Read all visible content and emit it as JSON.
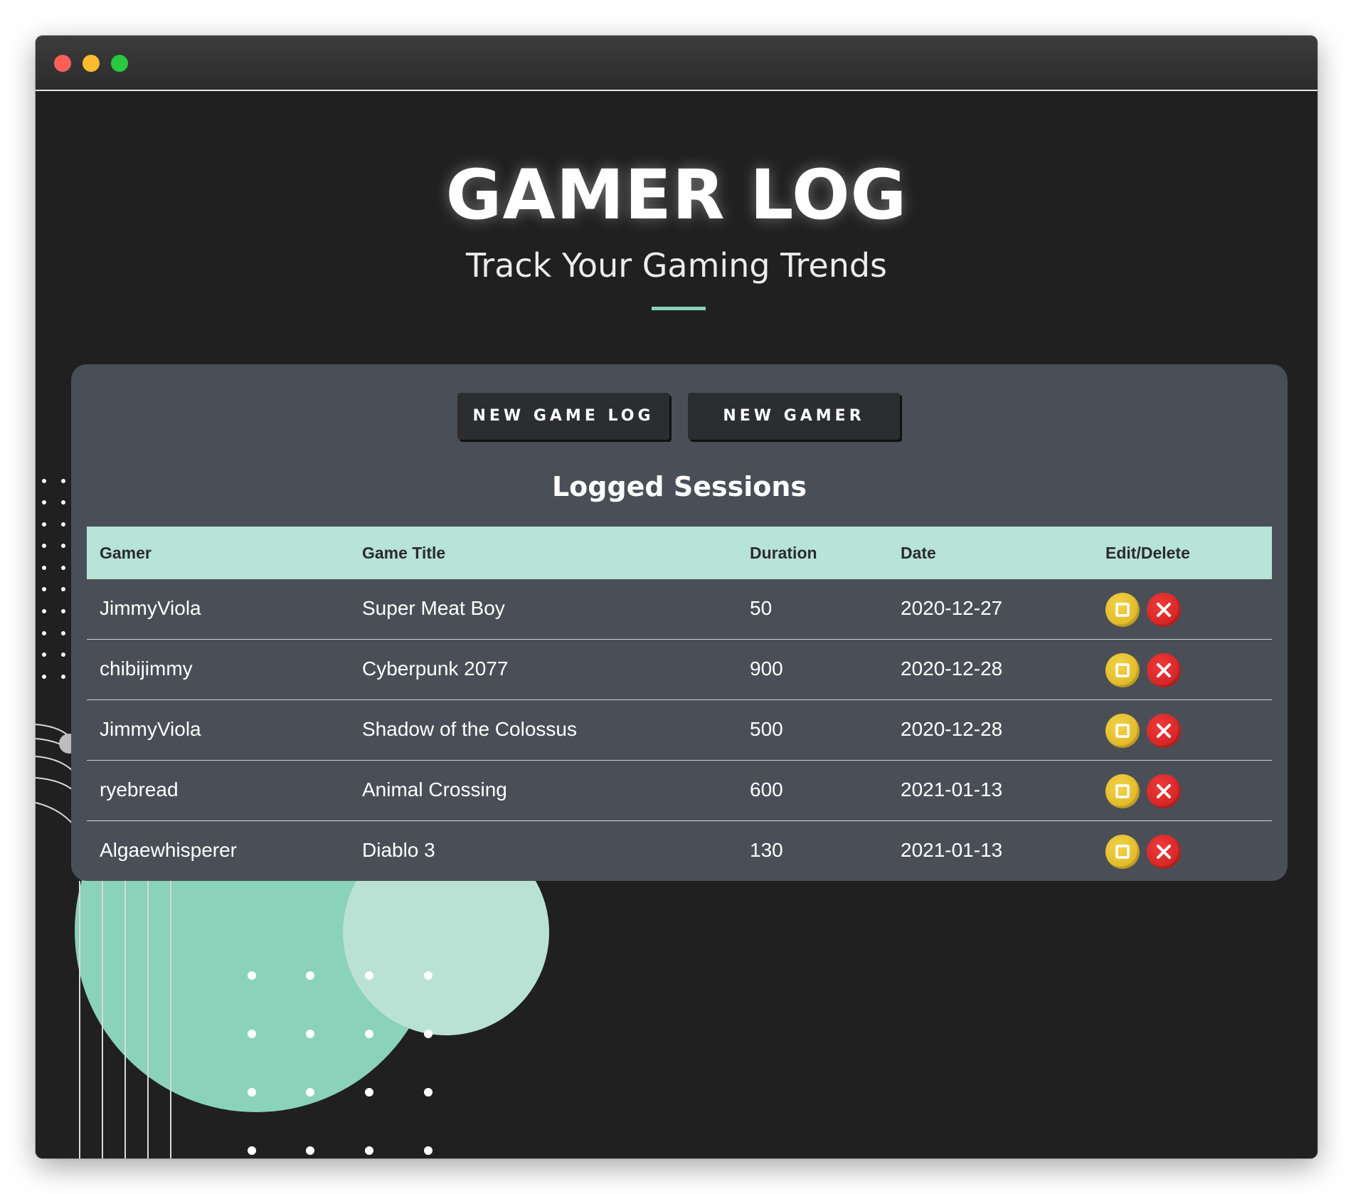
{
  "header": {
    "title": "GAMER LOG",
    "subtitle": "Track Your Gaming Trends"
  },
  "toolbar": {
    "new_game_log_label": "NEW GAME LOG",
    "new_gamer_label": "NEW GAMER"
  },
  "sessions": {
    "heading": "Logged Sessions",
    "columns": [
      "Gamer",
      "Game Title",
      "Duration",
      "Date",
      "Edit/Delete"
    ],
    "rows": [
      {
        "gamer": "JimmyViola",
        "game": "Super Meat Boy",
        "duration": "50",
        "date": "2020-12-27"
      },
      {
        "gamer": "chibijimmy",
        "game": "Cyberpunk 2077",
        "duration": "900",
        "date": "2020-12-28"
      },
      {
        "gamer": "JimmyViola",
        "game": "Shadow of the Colossus",
        "duration": "500",
        "date": "2020-12-28"
      },
      {
        "gamer": "ryebread",
        "game": "Animal Crossing",
        "duration": "600",
        "date": "2021-01-13"
      },
      {
        "gamer": "Algaewhisperer",
        "game": "Diablo 3",
        "duration": "130",
        "date": "2021-01-13"
      }
    ]
  },
  "icons": {
    "edit": "edit-icon",
    "delete": "delete-icon"
  },
  "colors": {
    "accent": "#85d2b8",
    "table_header": "#b8e3d7",
    "panel": "#4a4f57",
    "background": "#202020",
    "edit": "#e0b820",
    "delete": "#d62121"
  }
}
